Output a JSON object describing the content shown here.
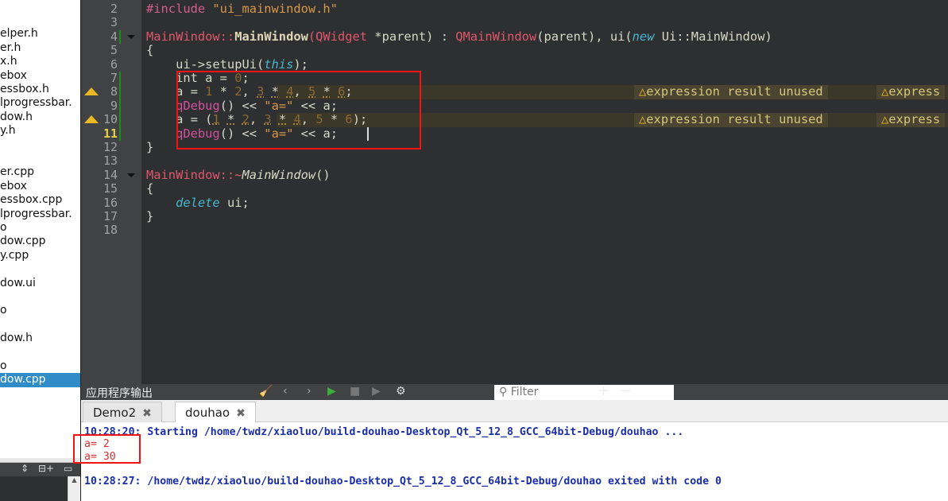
{
  "sidebar": {
    "items": [
      {
        "label": "elper.h",
        "row": 3
      },
      {
        "label": "er.h",
        "row": 4
      },
      {
        "label": "x.h",
        "row": 5
      },
      {
        "label": "ebox",
        "row": 6
      },
      {
        "label": "essbox.h",
        "row": 7
      },
      {
        "label": "lprogressbar.",
        "row": 8
      },
      {
        "label": "dow.h",
        "row": 9
      },
      {
        "label": "y.h",
        "row": 10
      },
      {
        "label": "er.cpp",
        "row": 13
      },
      {
        "label": "ebox",
        "row": 14
      },
      {
        "label": "essbox.cpp",
        "row": 15
      },
      {
        "label": "lprogressbar.",
        "row": 16
      },
      {
        "label": "o",
        "row": 17
      },
      {
        "label": "dow.cpp",
        "row": 18
      },
      {
        "label": "y.cpp",
        "row": 19
      },
      {
        "label": "dow.ui",
        "row": 21
      },
      {
        "label": "o",
        "row": 23
      },
      {
        "label": "dow.h",
        "row": 25
      },
      {
        "label": "o",
        "row": 27
      },
      {
        "label": "dow.cpp",
        "row": 28,
        "selected": true
      }
    ]
  },
  "editor": {
    "current_line": 11,
    "warning_lines": [
      8,
      10
    ],
    "lines": [
      {
        "n": 2,
        "tokens": [
          [
            "#include ",
            "t-pre"
          ],
          [
            "\"ui_mainwindow.h\"",
            "t-str"
          ]
        ]
      },
      {
        "n": 3,
        "tokens": []
      },
      {
        "n": 4,
        "fold": true,
        "tokens": [
          [
            "MainWindow::",
            "t-type"
          ],
          [
            "MainWindow",
            "t-fn"
          ],
          [
            "(",
            "t-type"
          ],
          [
            "QWidget ",
            "t-type"
          ],
          [
            "*parent",
            "t-fn-plain"
          ],
          [
            ") : ",
            ""
          ],
          [
            "QMainWindow",
            "t-type"
          ],
          [
            "(parent), ui(",
            ""
          ],
          [
            "new ",
            "t-this"
          ],
          [
            "Ui::MainWindow",
            ""
          ],
          [
            ")",
            ""
          ]
        ]
      },
      {
        "n": 5,
        "tokens": [
          [
            "{",
            ""
          ]
        ]
      },
      {
        "n": 6,
        "tokens": [
          [
            "    ui->setupUi(",
            ""
          ],
          [
            "this",
            "t-this"
          ],
          [
            ");",
            ""
          ]
        ]
      },
      {
        "n": 7,
        "tokens": [
          [
            "    int a = ",
            ""
          ],
          [
            "0",
            "t-num"
          ],
          [
            ";",
            ""
          ]
        ]
      },
      {
        "n": 8,
        "tokens": [
          [
            "    a = ",
            ""
          ],
          [
            "1",
            "t-num"
          ],
          [
            " * ",
            ""
          ],
          [
            "2",
            "t-num"
          ],
          [
            ", ",
            ""
          ],
          [
            "3",
            "t-num t-ul"
          ],
          [
            " ",
            ""
          ],
          [
            "*",
            "t-ul"
          ],
          [
            " ",
            ""
          ],
          [
            "4",
            "t-num t-ul"
          ],
          [
            ", ",
            ""
          ],
          [
            "5",
            "t-num t-ul"
          ],
          [
            " ",
            ""
          ],
          [
            "*",
            "t-ul"
          ],
          [
            " ",
            ""
          ],
          [
            "6",
            "t-num t-ul"
          ],
          [
            ";",
            ""
          ]
        ]
      },
      {
        "n": 9,
        "tokens": [
          [
            "    ",
            ""
          ],
          [
            "qDebug",
            "t-dbg"
          ],
          [
            "() << ",
            ""
          ],
          [
            "\"a=\"",
            "t-str"
          ],
          [
            " << a;",
            ""
          ]
        ]
      },
      {
        "n": 10,
        "tokens": [
          [
            "    a = (",
            ""
          ],
          [
            "1",
            "t-num t-ul"
          ],
          [
            " ",
            ""
          ],
          [
            "*",
            "t-ul"
          ],
          [
            " ",
            ""
          ],
          [
            "2",
            "t-num t-ul"
          ],
          [
            ", ",
            ""
          ],
          [
            "3",
            "t-num t-ul"
          ],
          [
            " ",
            ""
          ],
          [
            "*",
            "t-ul"
          ],
          [
            " ",
            ""
          ],
          [
            "4",
            "t-num t-ul"
          ],
          [
            ", ",
            ""
          ],
          [
            "5",
            "t-num"
          ],
          [
            " * ",
            ""
          ],
          [
            "6",
            "t-num"
          ],
          [
            ");",
            ""
          ]
        ]
      },
      {
        "n": 11,
        "tokens": [
          [
            "    ",
            ""
          ],
          [
            "qDebug",
            "t-dbg"
          ],
          [
            "() << ",
            ""
          ],
          [
            "\"a=\"",
            "t-str"
          ],
          [
            " << a;",
            ""
          ]
        ]
      },
      {
        "n": 12,
        "tokens": [
          [
            "}",
            ""
          ]
        ]
      },
      {
        "n": 13,
        "tokens": []
      },
      {
        "n": 14,
        "fold": true,
        "tokens": [
          [
            "MainWindow::~",
            "t-type"
          ],
          [
            "MainWindow",
            "t-italic"
          ],
          [
            "()",
            ""
          ]
        ]
      },
      {
        "n": 15,
        "tokens": [
          [
            "{",
            ""
          ]
        ]
      },
      {
        "n": 16,
        "tokens": [
          [
            "    ",
            ""
          ],
          [
            "delete",
            "t-del"
          ],
          [
            " ui;",
            ""
          ]
        ]
      },
      {
        "n": 17,
        "tokens": [
          [
            "}",
            ""
          ]
        ]
      },
      {
        "n": 18,
        "tokens": []
      }
    ],
    "warning_text": "expression result unused",
    "warning_text_truncated": "express"
  },
  "output_panel": {
    "title": "应用程序输出",
    "filter_placeholder": "Filter",
    "tabs": [
      {
        "label": "Demo2",
        "active": false
      },
      {
        "label": "douhao",
        "active": true
      }
    ],
    "lines": [
      {
        "text": "10:28:20: Starting /home/twdz/xiaoluo/build-douhao-Desktop_Qt_5_12_8_GCC_64bit-Debug/douhao ...",
        "kind": "sys"
      },
      {
        "text": "a= 2",
        "kind": "app"
      },
      {
        "text": "a= 30",
        "kind": "app"
      },
      {
        "text": "",
        "kind": "app"
      },
      {
        "text": "10:28:27: /home/twdz/xiaoluo/build-douhao-Desktop_Qt_5_12_8_GCC_64bit-Debug/douhao exited with code 0",
        "kind": "sys"
      }
    ]
  },
  "colors": {
    "highlight_box": "#f01414",
    "selection": "#308cc6",
    "warning": "#e8b923"
  }
}
